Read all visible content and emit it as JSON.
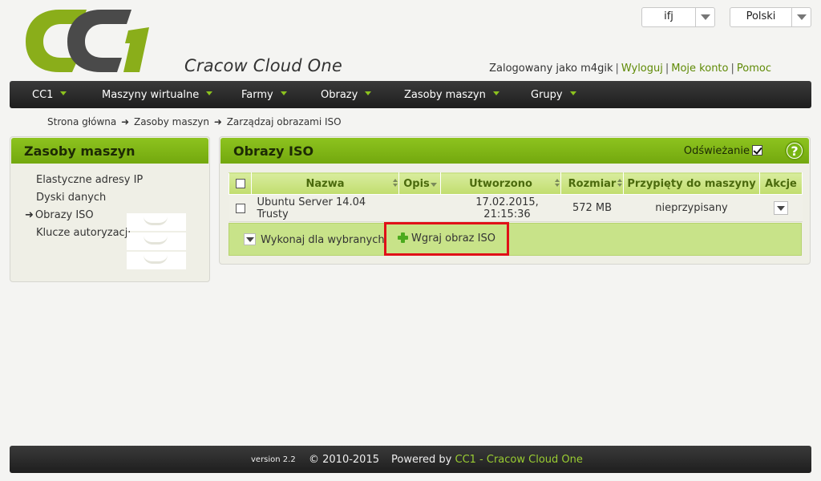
{
  "header": {
    "logo_text": "CC1",
    "logo_subtitle": "Cracow Cloud One",
    "user_select": "ifj",
    "language_select": "Polski",
    "logged_in_label": "Zalogowany jako m4gik",
    "logout": "Wyloguj",
    "my_account": "Moje konto",
    "help": "Pomoc",
    "separator": "|"
  },
  "nav": {
    "items": [
      {
        "label": "CC1"
      },
      {
        "label": "Maszyny wirtualne"
      },
      {
        "label": "Farmy"
      },
      {
        "label": "Obrazy"
      },
      {
        "label": "Zasoby maszyn"
      },
      {
        "label": "Grupy"
      }
    ]
  },
  "breadcrumb": {
    "items": [
      "Strona główna",
      "Zasoby maszyn",
      "Zarządzaj obrazami ISO"
    ],
    "separator": "➜"
  },
  "sidebar": {
    "title": "Zasoby maszyn",
    "active_marker": "➜",
    "items": [
      {
        "label": "Elastyczne adresy IP"
      },
      {
        "label": "Dyski danych"
      },
      {
        "label": "Obrazy ISO"
      },
      {
        "label": "Klucze autoryzacji"
      }
    ]
  },
  "main": {
    "title": "Obrazy ISO",
    "refresh_label": "Odświeżanie",
    "refresh_checked": true,
    "help_symbol": "?",
    "table": {
      "columns": [
        "Nazwa",
        "Opis",
        "Utworzono",
        "Rozmiar",
        "Przypięty do maszyny",
        "Akcje"
      ],
      "rows": [
        {
          "name": "Ubuntu Server 14.04 Trusty",
          "description": "",
          "created": "17.02.2015, 21:15:36",
          "size": "572 MB",
          "attached": "nieprzypisany"
        }
      ]
    },
    "bulk_action_label": "Wykonaj dla wybranych",
    "upload_label": "Wgraj obraz ISO"
  },
  "footer": {
    "version": "version 2.2",
    "copyright": "© 2010-2015",
    "powered_by": "Powered by",
    "powered_link": "CC1 - Cracow Cloud One"
  },
  "colors": {
    "accent": "#8cc21e",
    "logo_green": "#8aae1a",
    "logo_gray": "#4a4a4a",
    "highlight_red": "#e01018"
  }
}
